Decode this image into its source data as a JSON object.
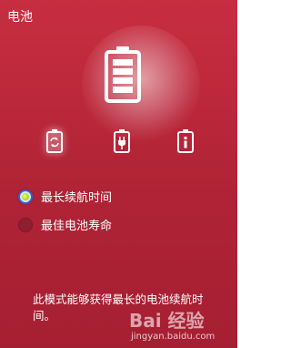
{
  "window": {
    "title": "电池"
  },
  "battery_modes": {
    "icons": [
      "battery-recycle-icon",
      "battery-plug-icon",
      "battery-info-icon"
    ],
    "active_index": 0
  },
  "options": [
    {
      "label": "最长续航时间",
      "selected": true
    },
    {
      "label": "最佳电池寿命",
      "selected": false
    }
  ],
  "description": "此模式能够获得最长的电池续航时间。",
  "watermark": {
    "logo": "Bai 经验",
    "url": "jingyan.baidu.com"
  },
  "colors": {
    "background": "#b32437",
    "radio_selected_dot": "#a7d312",
    "radio_border": "#3c5bd6"
  }
}
